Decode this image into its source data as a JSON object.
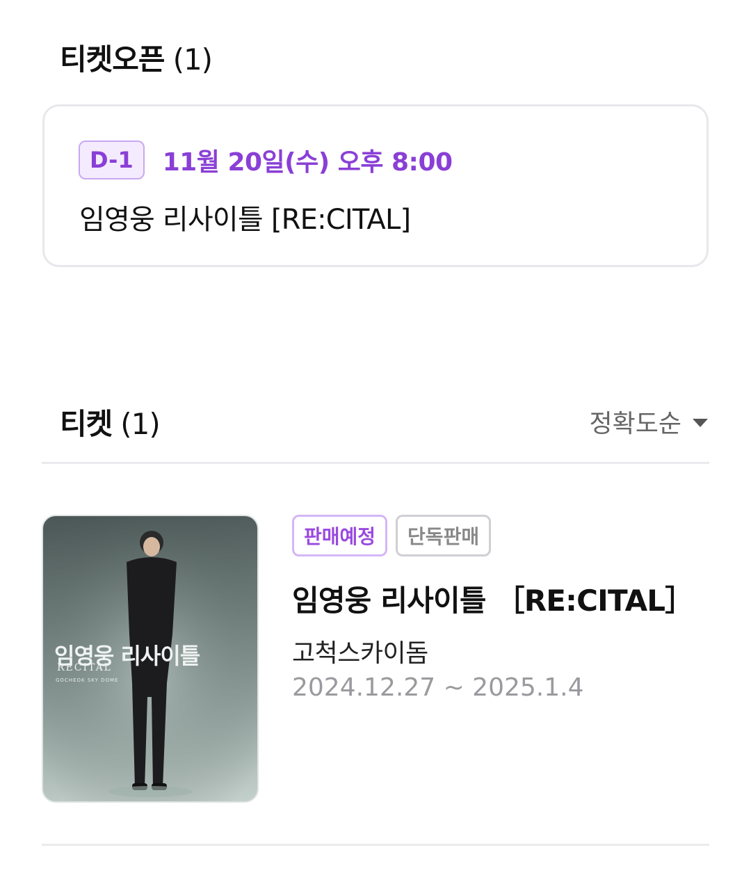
{
  "ticket_open_section": {
    "title": "티켓오픈",
    "count": "(1)",
    "item": {
      "dday": "D-1",
      "datetime": "11월 20일(수) 오후 8:00",
      "name": "임영웅 리사이틀 [RE:CITAL]"
    }
  },
  "ticket_section": {
    "title": "티켓",
    "count": "(1)",
    "sort_label": "정확도순",
    "items": [
      {
        "badges": [
          "판매예정",
          "단독판매"
        ],
        "name": "임영웅 리사이틀 ［RE:CITAL］",
        "venue": "고척스카이돔",
        "period": "2024.12.27 ~ 2025.1.4",
        "poster": {
          "title_kr": "임영웅 리사이틀",
          "title_en": "RECITAL",
          "venue_en": "GOCHEOK SKY DOME"
        }
      }
    ]
  },
  "colors": {
    "accent_purple": "#8a3fd6",
    "badge_purple_border": "#d4b6f6",
    "muted_text": "#9a9a9e",
    "divider": "#ebebee"
  },
  "icons": {
    "sort_caret": "caret-down-icon"
  }
}
